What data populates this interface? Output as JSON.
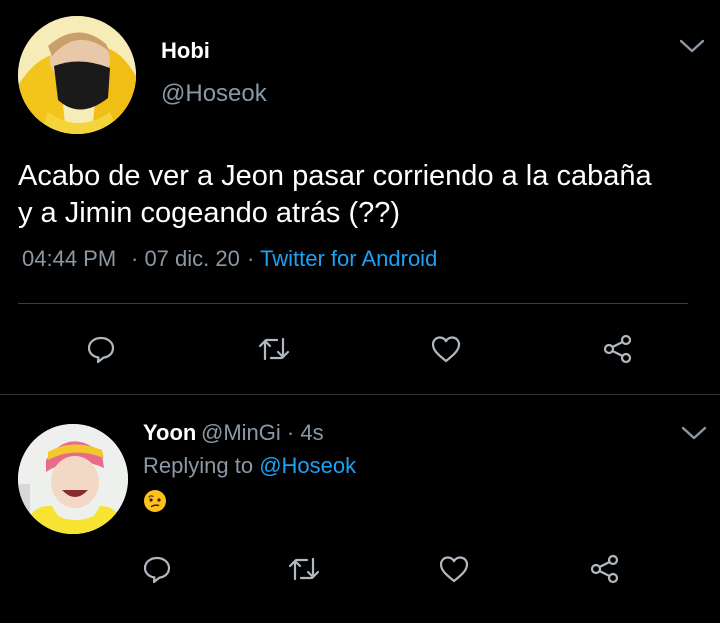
{
  "main_tweet": {
    "display_name": "Hobi",
    "handle": "@Hoseok",
    "text_line1": "Acabo de ver a Jeon pasar corriendo a la cabaña",
    "text_line2": "y a Jimin cogeando atrás (??)",
    "time": "04:44 PM",
    "date": "· 07 dic. 20",
    "source_sep": "·",
    "source": "Twitter for Android"
  },
  "reply": {
    "display_name": "Yoon",
    "handle_time": "@MinGi · 4s",
    "replying_prefix": "Replying to",
    "replying_to": "@Hoseok",
    "emoji_icon": "confused-face-icon"
  },
  "colors": {
    "background": "#000000",
    "text": "#ffffff",
    "muted": "#8b98a5",
    "link": "#1da1f2",
    "icon": "#b0b8c0"
  }
}
